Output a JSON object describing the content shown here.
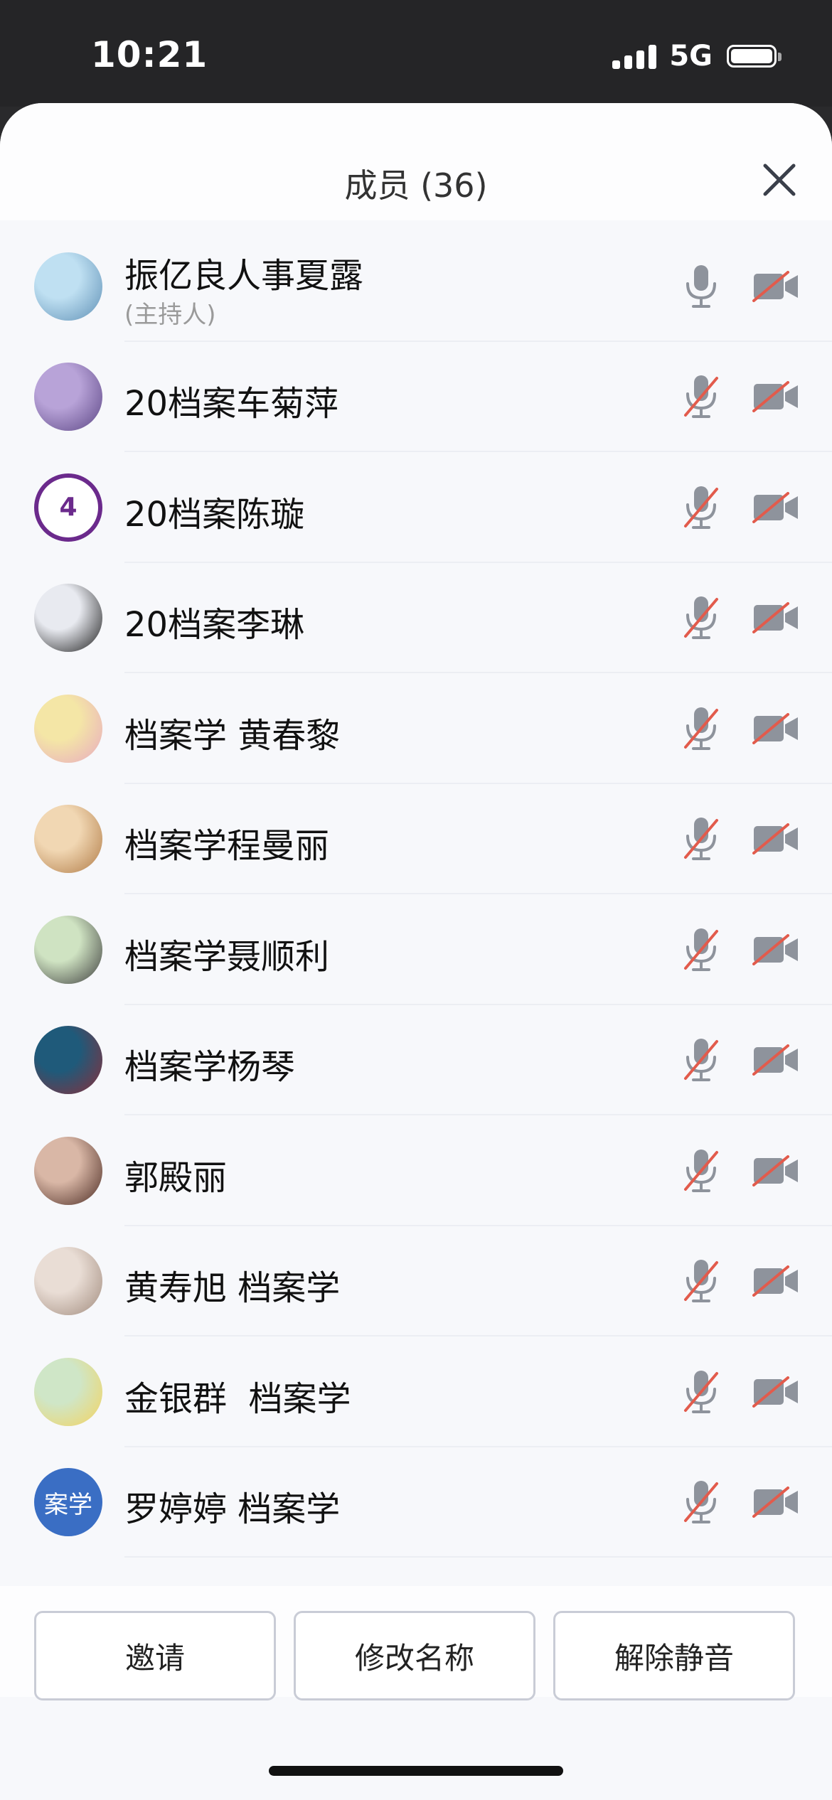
{
  "status_bar": {
    "time": "10:21",
    "network": "5G"
  },
  "sheet": {
    "title": "成员 (36)"
  },
  "members": [
    {
      "name": "振亿良人事夏露",
      "role": "(主持人)",
      "mic_muted": false,
      "camera_off": true,
      "avatar": "photo",
      "avatar_colors": [
        "#bfe0f2",
        "#5e8fb5"
      ]
    },
    {
      "name": "20档案车菊萍",
      "mic_muted": true,
      "camera_off": true,
      "avatar": "photo",
      "avatar_colors": [
        "#b8a3d8",
        "#5b4584"
      ]
    },
    {
      "name": "20档案陈璇",
      "mic_muted": true,
      "camera_off": true,
      "avatar": "badge",
      "avatar_colors": [
        "#ffffff",
        "#6b2a8c"
      ],
      "avatar_text": "4"
    },
    {
      "name": "20档案李琳",
      "mic_muted": true,
      "camera_off": true,
      "avatar": "photo",
      "avatar_colors": [
        "#e8eaf0",
        "#1c1c1c"
      ]
    },
    {
      "name": "档案学 黄春黎",
      "mic_muted": true,
      "camera_off": true,
      "avatar": "photo",
      "avatar_colors": [
        "#f4e6a6",
        "#e8a9c0"
      ]
    },
    {
      "name": "档案学程曼丽",
      "mic_muted": true,
      "camera_off": true,
      "avatar": "photo",
      "avatar_colors": [
        "#f1d7b3",
        "#b07a45"
      ]
    },
    {
      "name": "档案学聂顺利",
      "mic_muted": true,
      "camera_off": true,
      "avatar": "photo",
      "avatar_colors": [
        "#cfe3c2",
        "#3c3c3c"
      ]
    },
    {
      "name": "档案学杨琴",
      "mic_muted": true,
      "camera_off": true,
      "avatar": "photo",
      "avatar_colors": [
        "#1f5a7a",
        "#8b2e3a"
      ]
    },
    {
      "name": "郭殿丽",
      "mic_muted": true,
      "camera_off": true,
      "avatar": "photo",
      "avatar_colors": [
        "#d9b7a6",
        "#4a2a22"
      ]
    },
    {
      "name": "黄寿旭 档案学",
      "mic_muted": true,
      "camera_off": true,
      "avatar": "photo",
      "avatar_colors": [
        "#e9ddd5",
        "#a08a7c"
      ]
    },
    {
      "name": "金银群  档案学",
      "mic_muted": true,
      "camera_off": true,
      "avatar": "photo",
      "avatar_colors": [
        "#cfe6c7",
        "#f4d35e"
      ]
    },
    {
      "name": "罗婷婷 档案学",
      "mic_muted": true,
      "camera_off": true,
      "avatar": "initials",
      "avatar_colors": [
        "#3a6ec4",
        "#3a6ec4"
      ],
      "avatar_text": "案学"
    }
  ],
  "actions": {
    "invite": "邀请",
    "rename": "修改名称",
    "unmute_all": "解除静音"
  },
  "icons": {
    "close": "close-icon",
    "mic": "microphone-icon",
    "mic_muted": "microphone-muted-icon",
    "camera_off": "camera-off-icon"
  },
  "colors": {
    "muted_slash": "#e25b4c",
    "icon_gray": "#8e939c"
  }
}
